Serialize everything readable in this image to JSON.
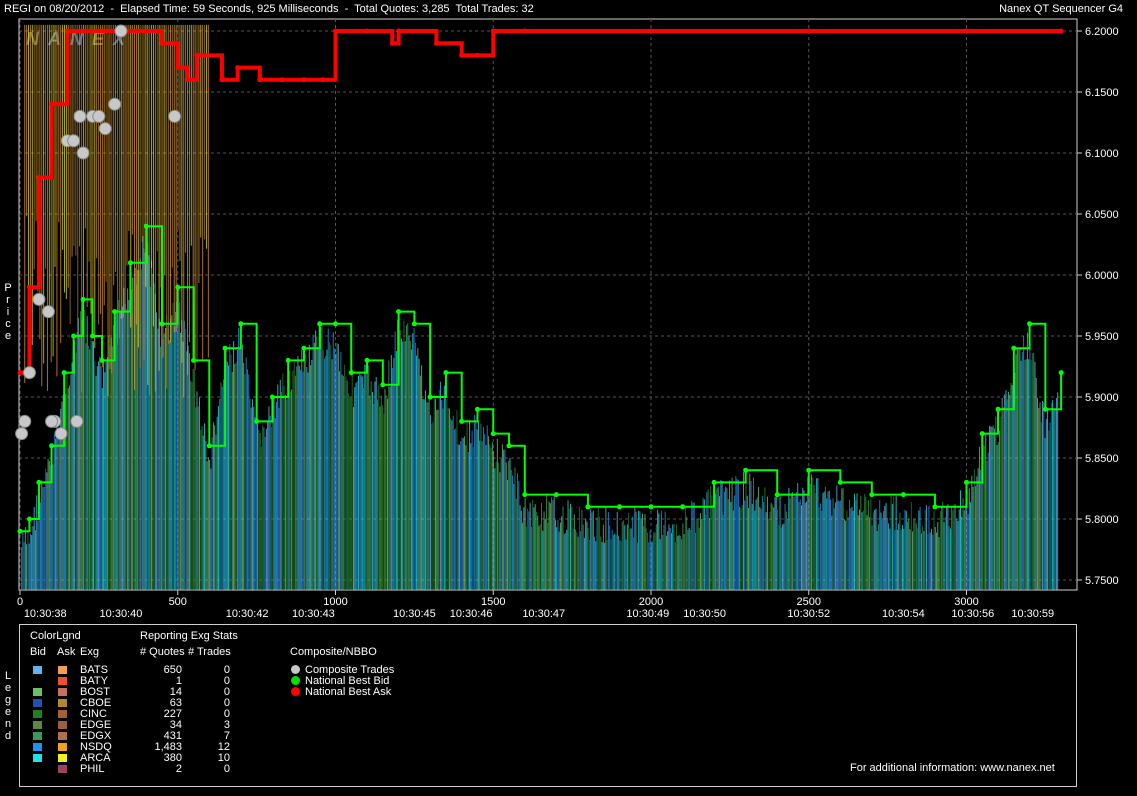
{
  "header": {
    "title": "REGI on 08/20/2012  -  Elapsed Time: 59 Seconds, 925 Milliseconds  -  Total Quotes: 3,285  Total Trades: 32",
    "app_name": "Nanex QT Sequencer G4",
    "watermark": "NANEX"
  },
  "y_axis_title": "Price",
  "legend_title": "Legend",
  "footer_text": "For additional information: www.nanex.net",
  "chart_data": {
    "type": "line",
    "title": "REGI on 08/20/2012",
    "ylabel": "Price",
    "ylim": [
      5.74,
      6.205
    ],
    "xlim": [
      0,
      3300
    ],
    "y_ticks": [
      "6.2000",
      "6.1500",
      "6.1000",
      "6.0500",
      "6.0000",
      "5.9500",
      "5.9000",
      "5.8500",
      "5.8000",
      "5.7500"
    ],
    "y_tick_values": [
      6.2,
      6.15,
      6.1,
      6.05,
      6.0,
      5.95,
      5.9,
      5.85,
      5.8,
      5.75
    ],
    "x_ticks": [
      {
        "v": 0,
        "label": "0"
      },
      {
        "v": 500,
        "label": "500"
      },
      {
        "v": 1000,
        "label": "1000"
      },
      {
        "v": 1500,
        "label": "1500"
      },
      {
        "v": 2000,
        "label": "2000"
      },
      {
        "v": 2500,
        "label": "2500"
      },
      {
        "v": 3000,
        "label": "3000"
      }
    ],
    "time_ticks": [
      {
        "v": 80,
        "label": "10:30:38"
      },
      {
        "v": 320,
        "label": "10:30:40"
      },
      {
        "v": 720,
        "label": "10:30:42"
      },
      {
        "v": 930,
        "label": "10:30:43"
      },
      {
        "v": 1250,
        "label": "10:30:45"
      },
      {
        "v": 1430,
        "label": "10:30:46"
      },
      {
        "v": 1660,
        "label": "10:30:47"
      },
      {
        "v": 1990,
        "label": "10:30:49"
      },
      {
        "v": 2170,
        "label": "10:30:50"
      },
      {
        "v": 2500,
        "label": "10:30:52"
      },
      {
        "v": 2800,
        "label": "10:30:54"
      },
      {
        "v": 3020,
        "label": "10:30:56"
      },
      {
        "v": 3210,
        "label": "10:30:59"
      }
    ],
    "series": [
      {
        "name": "National Best Ask",
        "color": "#ff0000",
        "x": [
          0,
          30,
          60,
          100,
          150,
          200,
          260,
          320,
          400,
          450,
          500,
          530,
          560,
          640,
          690,
          760,
          830,
          900,
          960,
          1000,
          1100,
          1180,
          1200,
          1320,
          1400,
          1450,
          1500,
          1600,
          2000,
          2500,
          3000,
          3300
        ],
        "y": [
          5.92,
          5.99,
          6.08,
          6.14,
          6.2,
          6.2,
          6.2,
          6.2,
          6.2,
          6.19,
          6.17,
          6.16,
          6.18,
          6.16,
          6.17,
          6.16,
          6.16,
          6.16,
          6.16,
          6.2,
          6.2,
          6.19,
          6.2,
          6.19,
          6.18,
          6.18,
          6.2,
          6.2,
          6.2,
          6.2,
          6.2,
          6.2
        ]
      },
      {
        "name": "National Best Bid",
        "color": "#00ff00",
        "x": [
          0,
          30,
          60,
          100,
          140,
          170,
          200,
          230,
          260,
          300,
          350,
          400,
          450,
          500,
          550,
          600,
          650,
          700,
          750,
          800,
          850,
          900,
          950,
          1000,
          1050,
          1100,
          1150,
          1200,
          1250,
          1300,
          1350,
          1400,
          1450,
          1500,
          1550,
          1600,
          1700,
          1800,
          1900,
          2000,
          2100,
          2200,
          2300,
          2400,
          2500,
          2600,
          2700,
          2800,
          2900,
          3000,
          3050,
          3100,
          3150,
          3200,
          3250,
          3300
        ],
        "y": [
          5.79,
          5.8,
          5.83,
          5.86,
          5.92,
          5.95,
          5.98,
          5.95,
          5.93,
          5.97,
          6.01,
          6.04,
          5.96,
          5.99,
          5.93,
          5.86,
          5.94,
          5.96,
          5.88,
          5.9,
          5.93,
          5.94,
          5.96,
          5.96,
          5.92,
          5.93,
          5.91,
          5.97,
          5.96,
          5.9,
          5.92,
          5.88,
          5.89,
          5.87,
          5.86,
          5.82,
          5.82,
          5.81,
          5.81,
          5.81,
          5.81,
          5.83,
          5.84,
          5.82,
          5.84,
          5.83,
          5.82,
          5.82,
          5.81,
          5.83,
          5.87,
          5.89,
          5.94,
          5.96,
          5.89,
          5.92
        ]
      }
    ],
    "trades": [
      {
        "x": 5,
        "y": 5.87
      },
      {
        "x": 15,
        "y": 5.88
      },
      {
        "x": 30,
        "y": 5.92
      },
      {
        "x": 60,
        "y": 5.98
      },
      {
        "x": 90,
        "y": 5.97
      },
      {
        "x": 110,
        "y": 5.88
      },
      {
        "x": 130,
        "y": 5.87
      },
      {
        "x": 150,
        "y": 6.11
      },
      {
        "x": 170,
        "y": 6.11
      },
      {
        "x": 200,
        "y": 6.1
      },
      {
        "x": 230,
        "y": 6.13
      },
      {
        "x": 270,
        "y": 6.12
      },
      {
        "x": 300,
        "y": 6.14
      },
      {
        "x": 320,
        "y": 6.2
      },
      {
        "x": 490,
        "y": 6.13
      },
      {
        "x": 190,
        "y": 6.13
      },
      {
        "x": 250,
        "y": 6.13
      },
      {
        "x": 100,
        "y": 5.88
      },
      {
        "x": 180,
        "y": 5.88
      }
    ]
  },
  "legend": {
    "color_legend_title": "ColorLgnd",
    "stats_title": "Reporting Exg Stats",
    "composite_title": "Composite/NBBO",
    "col_bid": "Bid",
    "col_ask": "Ask",
    "col_exg": "Exg",
    "col_quotes": "# Quotes",
    "col_trades": "# Trades",
    "exchanges": [
      {
        "name": "BATS",
        "bid_color": "#5fb5f0",
        "ask_color": "#f0a050",
        "quotes": "650",
        "trades": "0"
      },
      {
        "name": "BATY",
        "bid_color": "#000000",
        "ask_color": "#f05030",
        "quotes": "1",
        "trades": "0"
      },
      {
        "name": "BOST",
        "bid_color": "#6cc06c",
        "ask_color": "#c87060",
        "quotes": "14",
        "trades": "0"
      },
      {
        "name": "CBOE",
        "bid_color": "#2050b0",
        "ask_color": "#b08830",
        "quotes": "63",
        "trades": "0"
      },
      {
        "name": "CINC",
        "bid_color": "#208020",
        "ask_color": "#a86030",
        "quotes": "227",
        "trades": "0"
      },
      {
        "name": "EDGE",
        "bid_color": "#5a8a3a",
        "ask_color": "#9a6040",
        "quotes": "34",
        "trades": "3"
      },
      {
        "name": "EDGX",
        "bid_color": "#3a9a5a",
        "ask_color": "#b07050",
        "quotes": "431",
        "trades": "7"
      },
      {
        "name": "NSDQ",
        "bid_color": "#2090f0",
        "ask_color": "#f0a020",
        "quotes": "1,483",
        "trades": "12"
      },
      {
        "name": "ARCA",
        "bid_color": "#20e0f0",
        "ask_color": "#f0f020",
        "quotes": "380",
        "trades": "10"
      },
      {
        "name": "PHIL",
        "bid_color": "#000000",
        "ask_color": "#a04060",
        "quotes": "2",
        "trades": "0"
      }
    ],
    "composite": [
      {
        "label": "Composite Trades",
        "color": "#c8c8c8"
      },
      {
        "label": "National Best Bid",
        "color": "#00e000"
      },
      {
        "label": "National Best Ask",
        "color": "#ff0000"
      }
    ]
  }
}
